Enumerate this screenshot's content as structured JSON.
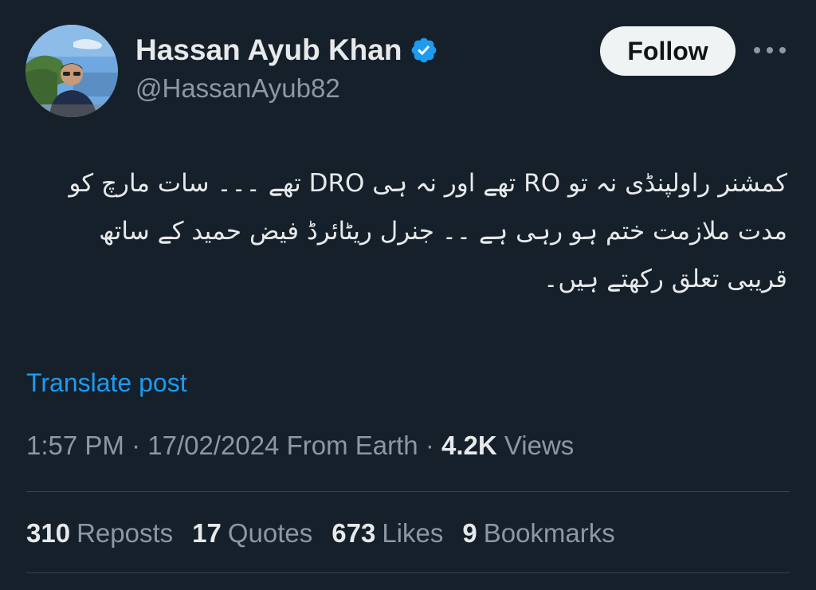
{
  "author": {
    "display_name": "Hassan Ayub Khan",
    "handle": "@HassanAyub82",
    "verified_color": "#1d9bf0"
  },
  "actions": {
    "follow_label": "Follow",
    "more_icon": "more-horizontal-icon"
  },
  "post": {
    "text": "کمشنر راولپنڈی نہ تو RO تھے اور نہ ہی DRO تھے ۔۔۔ سات مارچ کو مدت ملازمت ختم ہو رہی ہے ۔۔ جنرل ریٹائرڈ فیض حمید کے ساتھ قریبی تعلق رکھتے ہیں۔",
    "translate_label": "Translate post"
  },
  "meta": {
    "time": "1:57 PM",
    "separator": "·",
    "date": "17/02/2024",
    "location": "From Earth",
    "views_count": "4.2K",
    "views_label": "Views"
  },
  "stats": {
    "reposts_count": "310",
    "reposts_label": "Reposts",
    "quotes_count": "17",
    "quotes_label": "Quotes",
    "likes_count": "673",
    "likes_label": "Likes",
    "bookmarks_count": "9",
    "bookmarks_label": "Bookmarks"
  },
  "colors": {
    "background": "#15202b",
    "accent": "#1d9bf0",
    "secondary_text": "#8b98a5"
  }
}
